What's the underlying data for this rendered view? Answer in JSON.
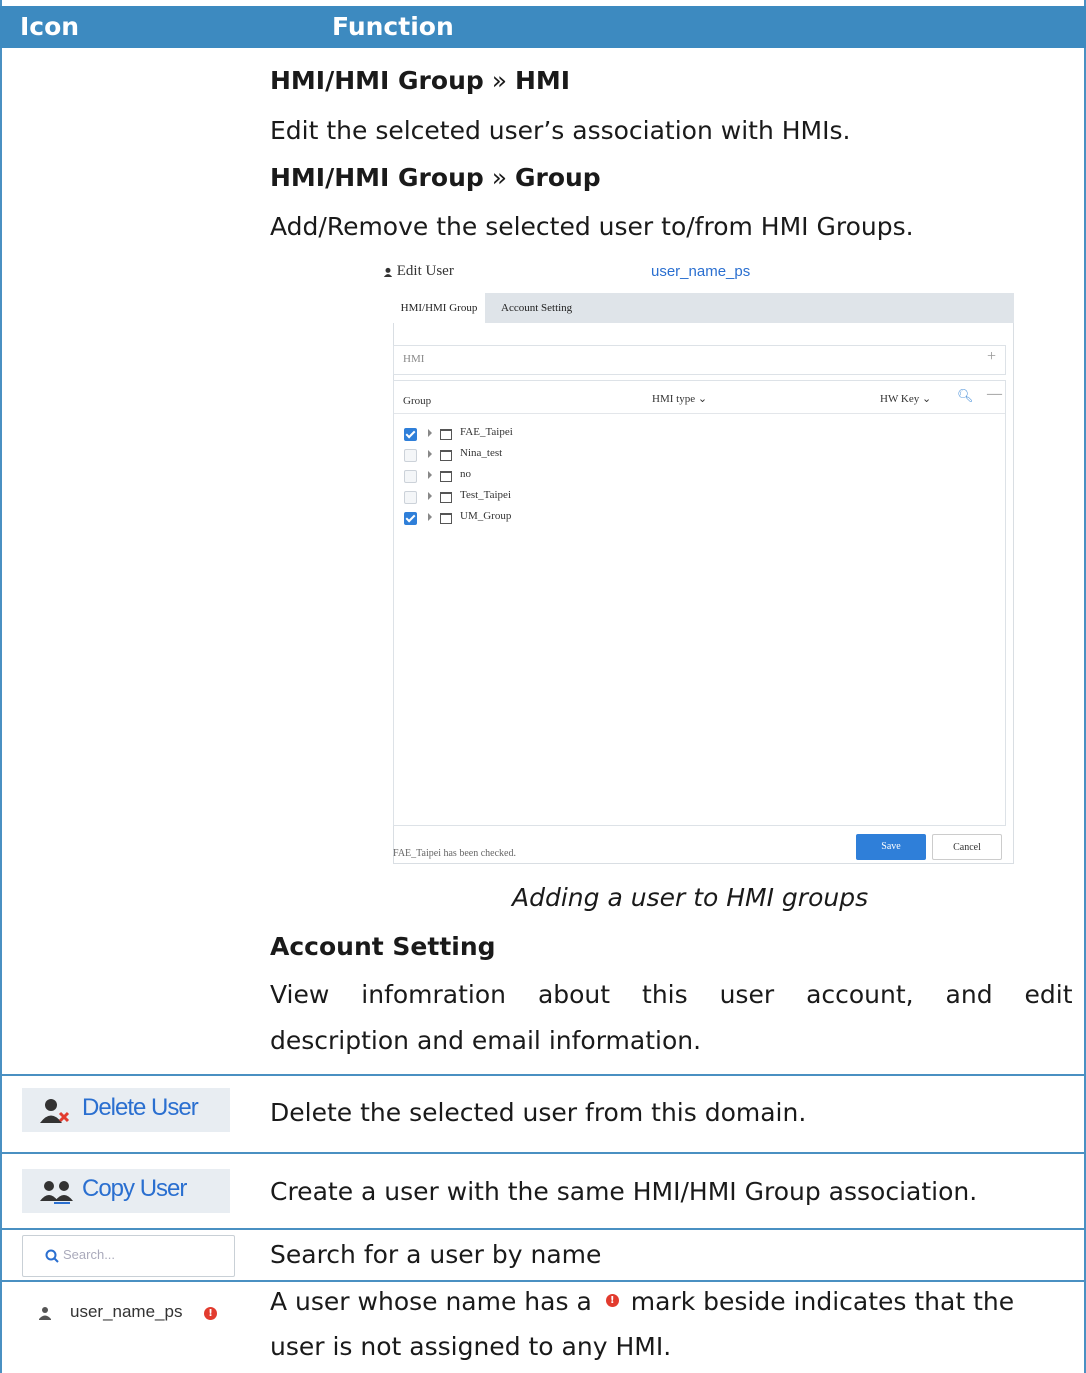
{
  "header": {
    "icon_col": "Icon",
    "function_col": "Function"
  },
  "hmi_section": {
    "heading1_a": "HMI/HMI Group",
    "heading1_sep": " » ",
    "heading1_b": "HMI",
    "desc1": "Edit the selceted user’s association with HMIs.",
    "heading2_a": "HMI/HMI Group",
    "heading2_sep": " » ",
    "heading2_b": "Group",
    "desc2": "Add/Remove the selected user to/from HMI Groups."
  },
  "dialog": {
    "title": "Edit User",
    "username": "user_name_ps",
    "tabs": [
      "HMI/HMI Group",
      "Account Setting"
    ],
    "hmi_label": "HMI",
    "plus": "+",
    "columns": {
      "group": "Group",
      "hmi_type": "HMI type ⌄",
      "hw_key": "HW Key ⌄"
    },
    "search_glyph": "🔍︎",
    "minus": "—",
    "groups": [
      {
        "name": "FAE_Taipei",
        "checked": true
      },
      {
        "name": "Nina_test",
        "checked": false
      },
      {
        "name": "no",
        "checked": false
      },
      {
        "name": "Test_Taipei",
        "checked": false
      },
      {
        "name": "UM_Group",
        "checked": true
      }
    ],
    "status": "FAE_Taipei has been checked.",
    "save": "Save",
    "cancel": "Cancel"
  },
  "caption": "Adding a user to HMI groups",
  "account_setting": {
    "heading": "Account Setting",
    "desc_line1": "View infomration about this user account, and edit",
    "desc_line2": "description and email information."
  },
  "rows": {
    "delete": {
      "label": "Delete User",
      "desc": "Delete the selected user from this domain."
    },
    "copy": {
      "label": "Copy User",
      "desc": "Create a user with the same HMI/HMI Group association."
    },
    "search": {
      "placeholder": "Search...",
      "desc": "Search for a user by name"
    },
    "user": {
      "name": "user_name_ps",
      "desc_a": "A user whose name has a",
      "desc_b": "mark beside indicates that the",
      "desc_line2": "user is not assigned to any HMI.",
      "warn_glyph": "!"
    }
  },
  "colors": {
    "header_bg": "#3d8ac0",
    "link_blue": "#2a6fd0",
    "warn_red": "#e23b2e"
  }
}
